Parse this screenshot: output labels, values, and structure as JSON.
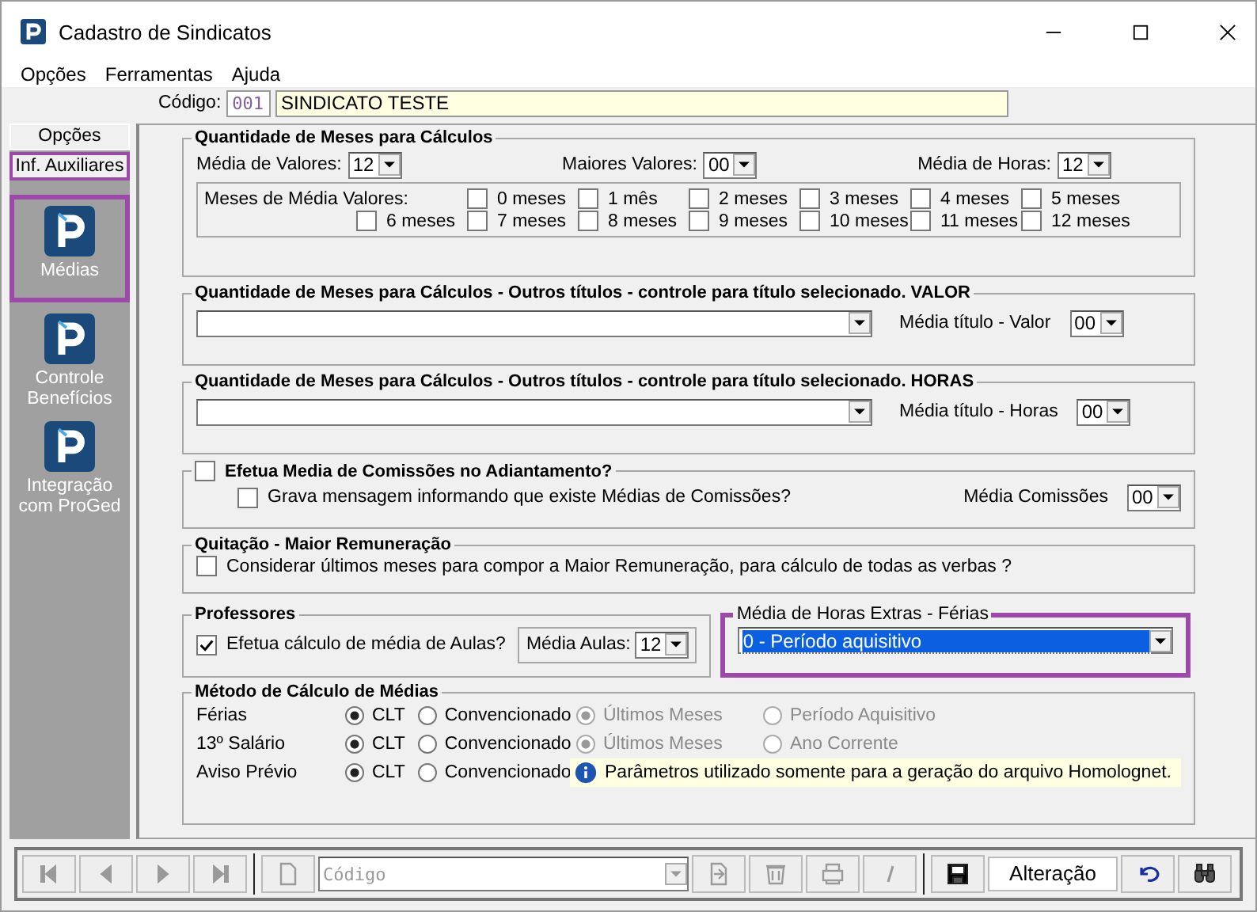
{
  "window": {
    "title": "Cadastro de Sindicatos"
  },
  "menu": [
    "Opções",
    "Ferramentas",
    "Ajuda"
  ],
  "codigo": {
    "label": "Código:",
    "code": "001",
    "name": "SINDICATO TESTE"
  },
  "sidebar": {
    "tabs": [
      {
        "label": "Opções",
        "selected": false
      },
      {
        "label": "Inf. Auxiliares",
        "selected": true
      }
    ],
    "items": [
      {
        "label": "Médias",
        "selected": true
      },
      {
        "label": "Controle Benefícios",
        "selected": false
      },
      {
        "label": "Integração com ProGed",
        "selected": false
      }
    ]
  },
  "quantidade": {
    "title": "Quantidade de Meses para Cálculos",
    "fields": [
      {
        "label": "Média de Valores:",
        "value": "12"
      },
      {
        "label": "Maiores Valores:",
        "value": "00"
      },
      {
        "label": "Média de Horas:",
        "value": "12"
      }
    ],
    "meses_label": "Meses de Média Valores:",
    "meses": [
      {
        "label": "0 meses",
        "checked": false
      },
      {
        "label": "1 mês",
        "checked": false
      },
      {
        "label": "2 meses",
        "checked": false
      },
      {
        "label": "3 meses",
        "checked": false
      },
      {
        "label": "4 meses",
        "checked": false
      },
      {
        "label": "5 meses",
        "checked": false
      },
      {
        "label": "6 meses",
        "checked": false
      },
      {
        "label": "7 meses",
        "checked": false
      },
      {
        "label": "8 meses",
        "checked": false
      },
      {
        "label": "9 meses",
        "checked": false
      },
      {
        "label": "10 meses",
        "checked": false
      },
      {
        "label": "11 meses",
        "checked": false
      },
      {
        "label": "12 meses",
        "checked": false
      }
    ]
  },
  "outros": [
    {
      "title": "Quantidade de Meses para Cálculos - Outros títulos - controle para título selecionado. VALOR",
      "label": "Média título - Valor",
      "value": "00"
    },
    {
      "title": "Quantidade de Meses para Cálculos - Outros títulos - controle para título selecionado. HORAS",
      "label": "Média título - Horas",
      "value": "00"
    }
  ],
  "comissoes": {
    "title": "Efetua Media de Comissões no Adiantamento?",
    "checked": false,
    "option": {
      "label": "Grava mensagem informando que existe Médias de Comissões?",
      "checked": false
    },
    "label": "Média Comissões",
    "value": "00"
  },
  "quitacao": {
    "title": "Quitação - Maior Remuneração",
    "option": {
      "label": "Considerar últimos meses para compor a Maior Remuneração, para cálculo de todas as verbas ?",
      "checked": false
    }
  },
  "professores": {
    "title": "Professores",
    "option": {
      "label": "Efetua cálculo de média de Aulas?",
      "checked": true
    },
    "label": "Média Aulas:",
    "value": "12"
  },
  "horas_extras": {
    "title": "Média de Horas Extras - Férias",
    "value": "0 - Período aquisitivo",
    "focused": true
  },
  "metodo": {
    "title": "Método de Cálculo de Médias",
    "rows": [
      {
        "label": "Férias",
        "options": [
          {
            "label": "CLT",
            "selected": true
          },
          {
            "label": "Convencionado",
            "selected": false
          }
        ],
        "extra": [
          {
            "label": "Últimos Meses",
            "selected": true
          },
          {
            "label": "Período Aquisitivo",
            "selected": false
          }
        ]
      },
      {
        "label": "13º Salário",
        "options": [
          {
            "label": "CLT",
            "selected": true
          },
          {
            "label": "Convencionado",
            "selected": false
          }
        ],
        "extra": [
          {
            "label": "Últimos Meses",
            "selected": true
          },
          {
            "label": "Ano Corrente",
            "selected": false
          }
        ]
      },
      {
        "label": "Aviso Prévio",
        "options": [
          {
            "label": "CLT",
            "selected": true
          },
          {
            "label": "Convencionado",
            "selected": false
          }
        ]
      }
    ],
    "extra_disabled": true,
    "note": "Parâmetros utilizado somente para a geração do arquivo Homolognet."
  },
  "toolbar": [
    {
      "kind": "first",
      "disabled": true
    },
    {
      "kind": "prev",
      "disabled": true
    },
    {
      "kind": "next",
      "disabled": true
    },
    {
      "kind": "last",
      "disabled": true
    },
    {
      "kind": "sep"
    },
    {
      "kind": "new",
      "disabled": true
    },
    {
      "kind": "search",
      "placeholder": "Código"
    },
    {
      "kind": "import",
      "disabled": true
    },
    {
      "kind": "delete",
      "disabled": true
    },
    {
      "kind": "print",
      "disabled": true
    },
    {
      "kind": "italic",
      "disabled": true
    },
    {
      "kind": "sep"
    },
    {
      "kind": "save",
      "disabled": false
    },
    {
      "kind": "mode",
      "text": "Alteração"
    },
    {
      "kind": "undo",
      "disabled": false
    },
    {
      "kind": "find",
      "disabled": false
    }
  ]
}
